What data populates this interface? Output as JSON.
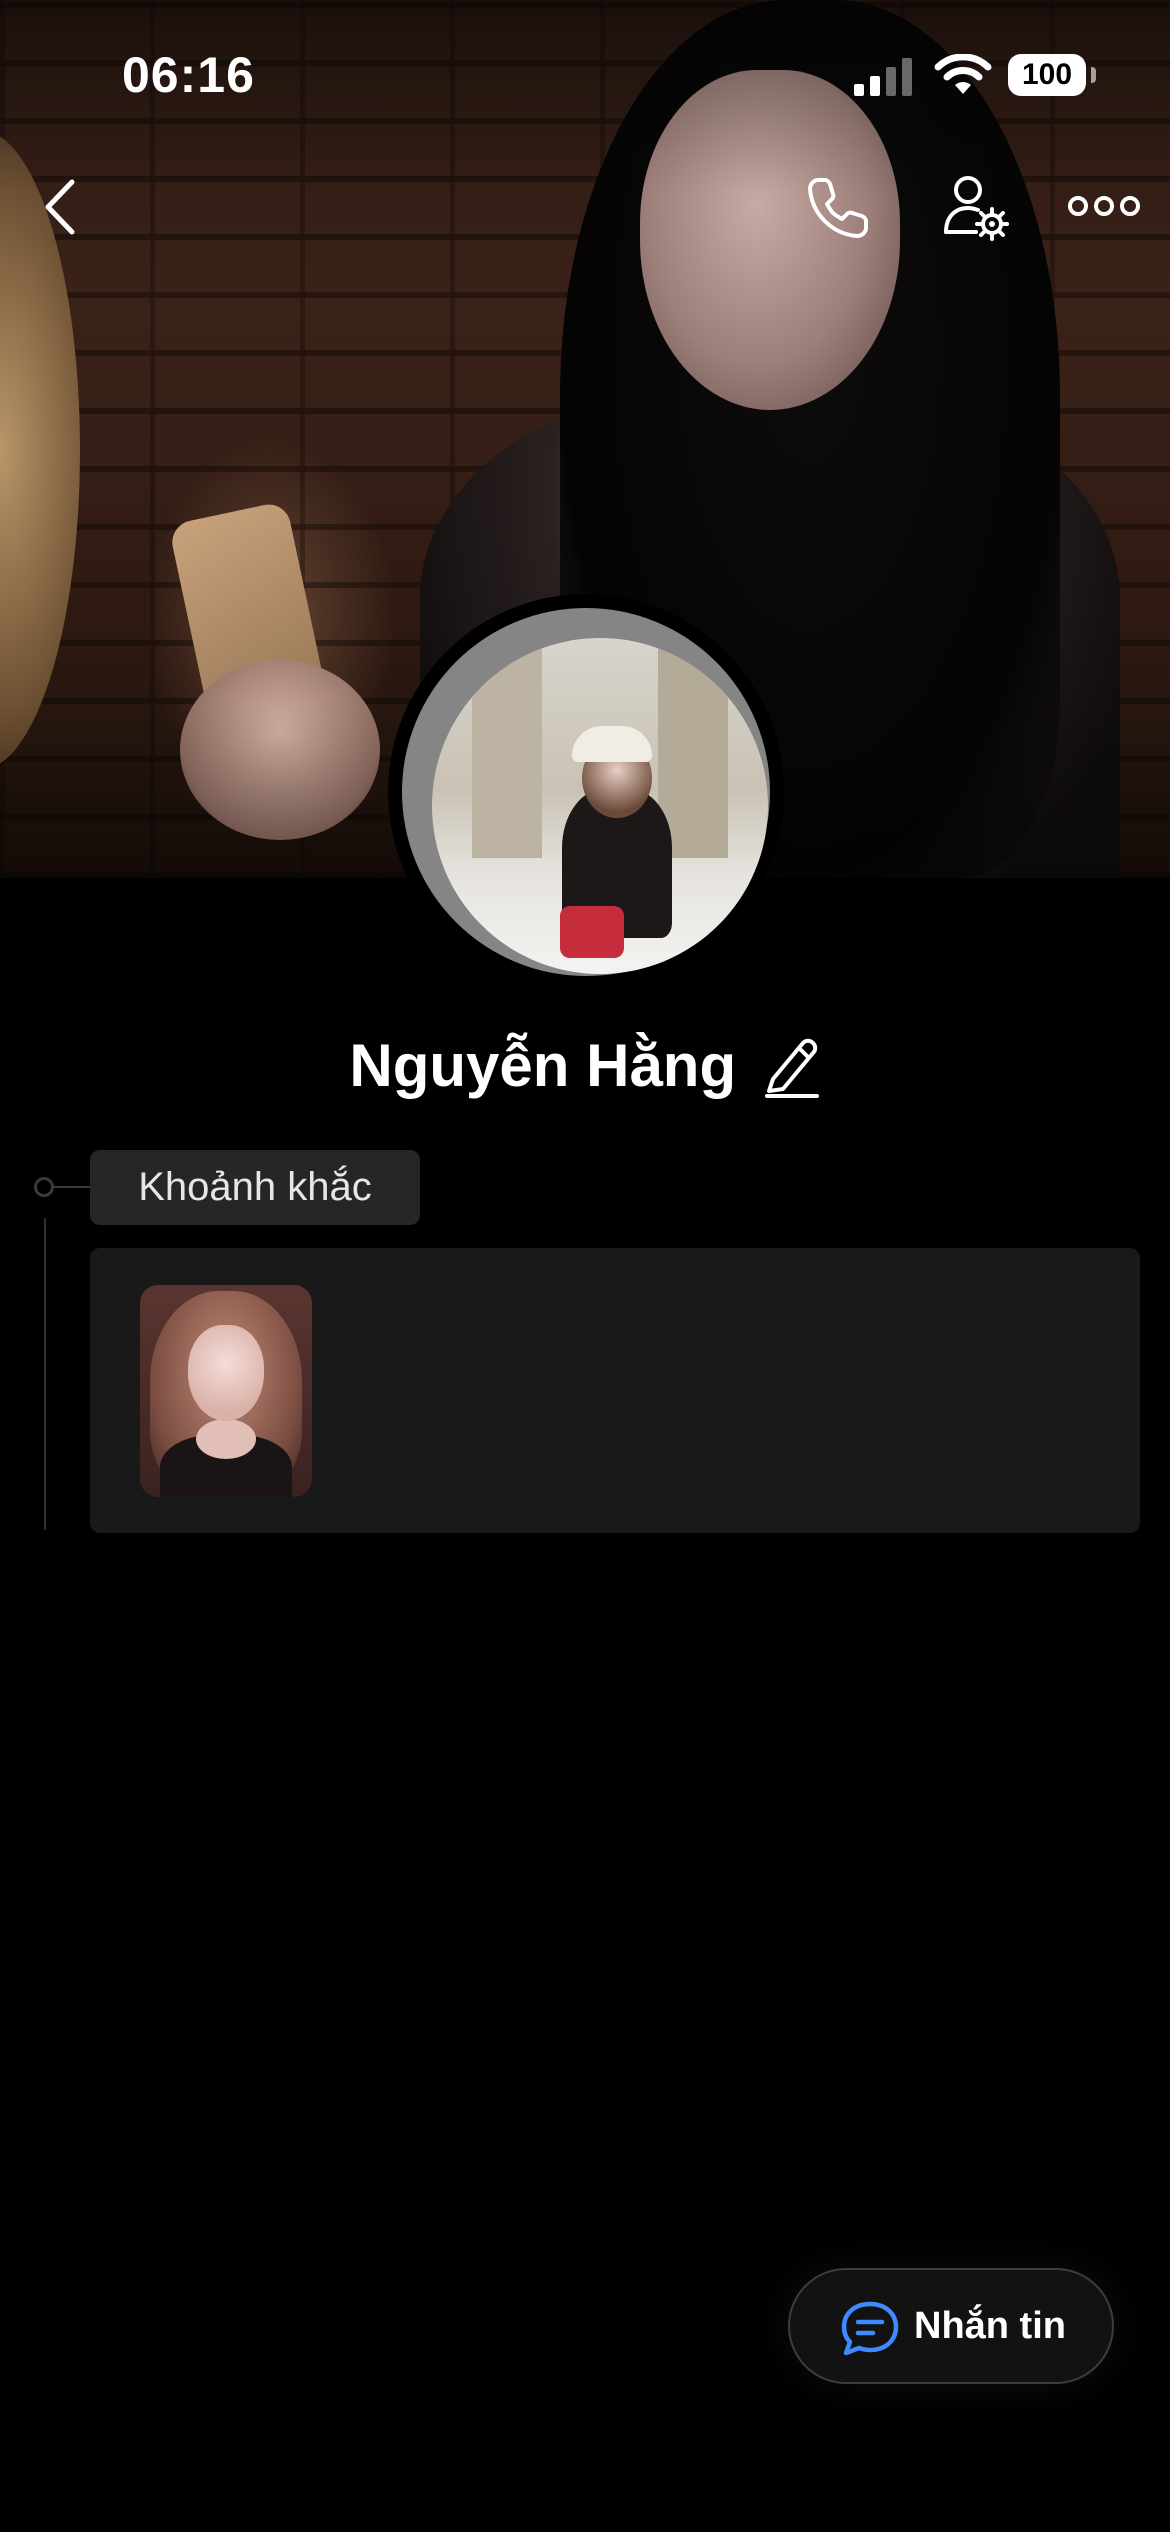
{
  "status_bar": {
    "time": "06:16",
    "battery": "100"
  },
  "nav": {
    "back_icon": "chevron-left-icon",
    "call_icon": "phone-icon",
    "settings_icon": "user-settings-icon",
    "more_icon": "more-horizontal-icon"
  },
  "profile": {
    "name": "Nguyễn Hằng"
  },
  "moments": {
    "label": "Khoảnh khắc"
  },
  "actions": {
    "message_label": "Nhắn tin"
  },
  "colors": {
    "background": "#000000",
    "accent": "#3d8bff",
    "card": "#191919",
    "chip": "#262626"
  }
}
